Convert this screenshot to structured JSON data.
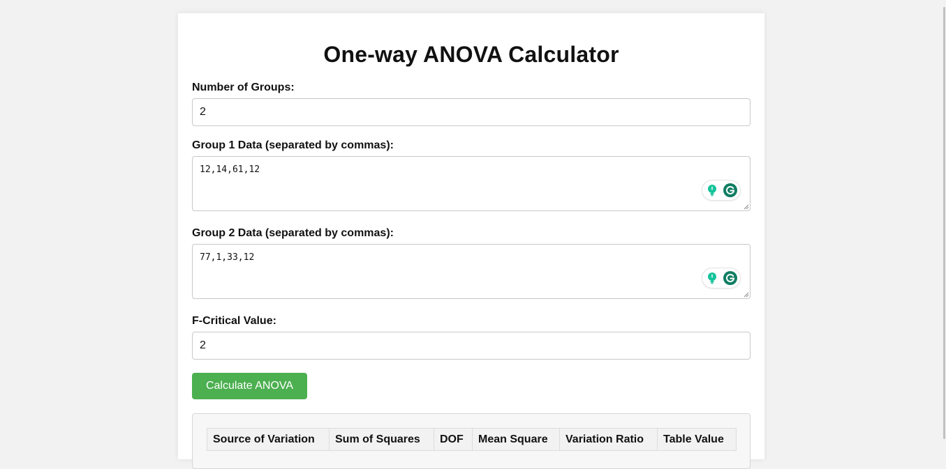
{
  "page": {
    "title": "One-way ANOVA Calculator"
  },
  "form": {
    "groups_label": "Number of Groups:",
    "groups_value": "2",
    "group1_label": "Group 1 Data (separated by commas):",
    "group1_value": "12,14,61,12",
    "group2_label": "Group 2 Data (separated by commas):",
    "group2_value": "77,1,33,12",
    "fcrit_label": "F-Critical Value:",
    "fcrit_value": "2",
    "calculate_label": "Calculate ANOVA"
  },
  "result_table": {
    "headers": [
      "Source of Variation",
      "Sum of Squares",
      "DOF",
      "Mean Square",
      "Variation Ratio",
      "Table Value"
    ]
  },
  "icons": {
    "grammarly_bulb": "lightbulb-icon",
    "grammarly_logo": "grammarly-g-icon"
  },
  "colors": {
    "button": "#4caf50",
    "grammarly": "#15c39a",
    "grammarly_dark": "#0f7d63"
  }
}
